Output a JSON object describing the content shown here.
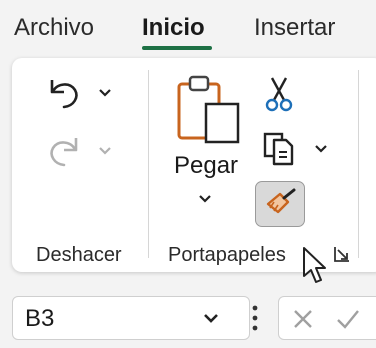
{
  "tabs": [
    {
      "label": "Archivo"
    },
    {
      "label": "Inicio",
      "active": true
    },
    {
      "label": "Insertar"
    }
  ],
  "groups": {
    "undo": {
      "label": "Deshacer"
    },
    "clipboard": {
      "label": "Portapapeles",
      "paste_label": "Pegar"
    }
  },
  "formula_bar": {
    "name_box_value": "B3"
  },
  "colors": {
    "accent": "#1e7145",
    "brush_orange": "#c8641e",
    "clipboard_orange": "#c8641e"
  }
}
